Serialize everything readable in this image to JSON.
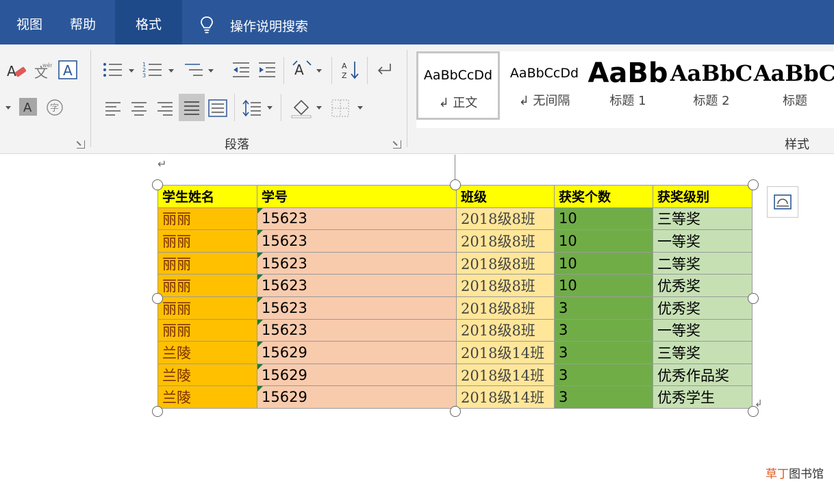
{
  "tabs": [
    {
      "label": "视图",
      "active": false
    },
    {
      "label": "帮助",
      "active": false
    },
    {
      "label": "格式",
      "active": true
    }
  ],
  "tell_me": {
    "text": "操作说明搜索",
    "icon": "lightbulb-icon"
  },
  "ribbon": {
    "paragraph_group_label": "段落",
    "styles_group_label": "样式",
    "styles": [
      {
        "sample": "AaBbCcDd",
        "name": "↲ 正文",
        "selected": true
      },
      {
        "sample": "AaBbCcDd",
        "name": "↲ 无间隔",
        "selected": false
      },
      {
        "sample": "AaBb",
        "name": "标题 1",
        "selected": false
      },
      {
        "sample": "AaBbC",
        "name": "标题 2",
        "selected": false
      },
      {
        "sample": "AaBbC",
        "name": "标题",
        "selected": false
      }
    ],
    "font_icons": [
      "text-highlight-icon",
      "phonetic-guide-icon",
      "character-border-icon",
      "character-shading-icon",
      "enclose-character-icon"
    ],
    "paragraph_icons": [
      "bullets-icon",
      "numbering-icon",
      "multilevel-list-icon",
      "decrease-indent-icon",
      "increase-indent-icon",
      "chinese-layout-icon",
      "sort-icon",
      "show-marks-icon",
      "align-left-icon",
      "center-icon",
      "align-right-icon",
      "justify-icon",
      "distributed-icon",
      "line-spacing-icon",
      "shading-icon",
      "borders-icon"
    ]
  },
  "document": {
    "paragraph_mark": "↵",
    "table": {
      "headers": [
        "学生姓名",
        "学号",
        "班级",
        "获奖个数",
        "获奖级别"
      ],
      "rows": [
        [
          "丽丽",
          "15623",
          "2018级8班",
          "10",
          "三等奖"
        ],
        [
          "丽丽",
          "15623",
          "2018级8班",
          "10",
          "一等奖"
        ],
        [
          "丽丽",
          "15623",
          "2018级8班",
          "10",
          "二等奖"
        ],
        [
          "丽丽",
          "15623",
          "2018级8班",
          "10",
          "优秀奖"
        ],
        [
          "丽丽",
          "15623",
          "2018级8班",
          "3",
          "优秀奖"
        ],
        [
          "丽丽",
          "15623",
          "2018级8班",
          "3",
          "一等奖"
        ],
        [
          "兰陵",
          "15629",
          "2018级14班",
          "3",
          "三等奖"
        ],
        [
          "兰陵",
          "15629",
          "2018级14班",
          "3",
          "优秀作品奖"
        ],
        [
          "兰陵",
          "15629",
          "2018级14班",
          "3",
          "优秀学生"
        ]
      ],
      "colors": {
        "header": "#ffff00",
        "name": "#ffc000",
        "id": "#f8cbad",
        "class": "#ffe699",
        "count": "#70ad47",
        "level": "#c6e0b4"
      }
    },
    "layout_options_icon": "layout-options-icon"
  },
  "watermark": {
    "accent": "草丁",
    "rest": "图书馆"
  }
}
